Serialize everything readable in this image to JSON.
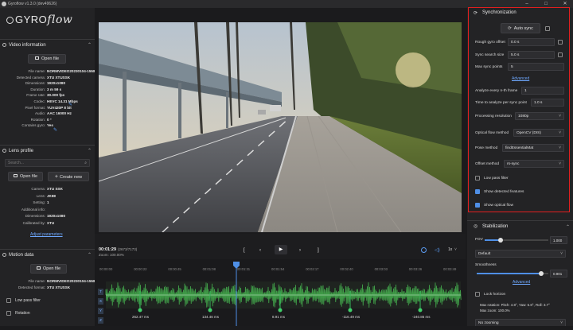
{
  "titlebar": {
    "title": "Gyroflow v1.3.0 (dev49626)",
    "minimize": "–",
    "maximize": "□",
    "close": "✕"
  },
  "logo": {
    "gyro": "GYRO",
    "flow": "flow"
  },
  "video_info": {
    "title": "Video information",
    "open_file": "Open file",
    "rows": [
      {
        "k": "File name:",
        "v": "NORMVIDEO20230104-1558"
      },
      {
        "k": "Detected camera:",
        "v": "XTU XTUSSK"
      },
      {
        "k": "Dimensions:",
        "v": "1920x1080"
      },
      {
        "k": "Duration:",
        "v": "3 m 59 s"
      },
      {
        "k": "Frame rate:",
        "v": "30.000 fps"
      },
      {
        "k": "Codec:",
        "v": "HEVC 14.31 Mbps"
      },
      {
        "k": "Pixel format:",
        "v": "YUV420P 8 bit"
      },
      {
        "k": "Audio:",
        "v": "AAC 16000 Hz"
      },
      {
        "k": "Rotation:",
        "v": "0 °"
      },
      {
        "k": "Contains gyro:",
        "v": "Yes"
      }
    ]
  },
  "lens_profile": {
    "title": "Lens profile",
    "search_placeholder": "Search...",
    "open_file": "Open file",
    "create_new": "Create new",
    "rows": [
      {
        "k": "Camera:",
        "v": "XTU SSK"
      },
      {
        "k": "Lens:",
        "v": "JK88"
      },
      {
        "k": "Setting:",
        "v": "1"
      },
      {
        "k": "Additional info:",
        "v": ""
      },
      {
        "k": "Dimensions:",
        "v": "1920x1080"
      },
      {
        "k": "Calibrated by:",
        "v": "XTU"
      }
    ],
    "adjust_link": "Adjust parameters"
  },
  "motion_data": {
    "title": "Motion data",
    "open_file": "Open file",
    "rows": [
      {
        "k": "File name:",
        "v": "NORMVIDEO20230104-1558"
      },
      {
        "k": "Detected format:",
        "v": "XTU XTUSSK"
      }
    ],
    "low_pass": "Low pass filter",
    "rotation": "Rotation"
  },
  "transport": {
    "time": "00:01:29",
    "frame": "(2673/7173)",
    "zoom": "Zoom: 100.00%",
    "speed": "1x",
    "ticks": [
      "00:00:00",
      "00:00:22",
      "00:00:45",
      "00:01:08",
      "00:01:31",
      "00:01:54",
      "00:02:17",
      "00:02:40",
      "00:03:03",
      "00:03:26",
      "00:03:49"
    ],
    "side_labels": [
      "T",
      "X",
      "Y",
      "Z"
    ],
    "sync_points": [
      "262.47 ms",
      "134.46 ms",
      "8.91 ms",
      "-116.49 ms",
      "-240.86 ms"
    ]
  },
  "sync": {
    "title": "Synchronization",
    "auto_sync": "Auto sync",
    "rough_offset_label": "Rough gyro offset",
    "rough_offset_value": "0.0 s",
    "search_size_label": "Sync search size",
    "search_size_value": "5.0 s",
    "max_points_label": "Max sync points",
    "max_points_value": "5",
    "advanced": "Advanced",
    "every_nth_label": "Analyze every n-th frame",
    "every_nth_value": "1",
    "time_per_point_label": "Time to analyze per sync point",
    "time_per_point_value": "1.0 s",
    "proc_res_label": "Processing resolution",
    "proc_res_value": "1080p",
    "optical_flow_label": "Optical flow method",
    "optical_flow_value": "OpenCV (DIS)",
    "pose_label": "Pose method",
    "pose_value": "findEssentialMat",
    "offset_label": "Offset method",
    "offset_value": "rs-sync",
    "low_pass": "Low pass filter",
    "show_features": "Show detected features",
    "show_flow": "Show optical flow"
  },
  "stabilization": {
    "title": "Stabilization",
    "fov_label": "FOV",
    "fov_value": "1.000",
    "fov_level": 0.25,
    "preset_value": "Default",
    "smoothness_label": "Smoothness",
    "smoothness_value": "0.901",
    "smoothness_level": 0.9,
    "advanced": "Advanced",
    "lock_horizon": "Lock horizon",
    "max_rotation": "Max rotation: Pitch: 4.8°, Yaw: 5.8°, Roll: 3.7°",
    "max_zoom": "Max zoom: 100.0%",
    "zooming_value": "No zooming"
  },
  "colors": {
    "accent": "#4f8fe6",
    "highlight": "#e21f1f",
    "waveform": "#3f9a47"
  }
}
